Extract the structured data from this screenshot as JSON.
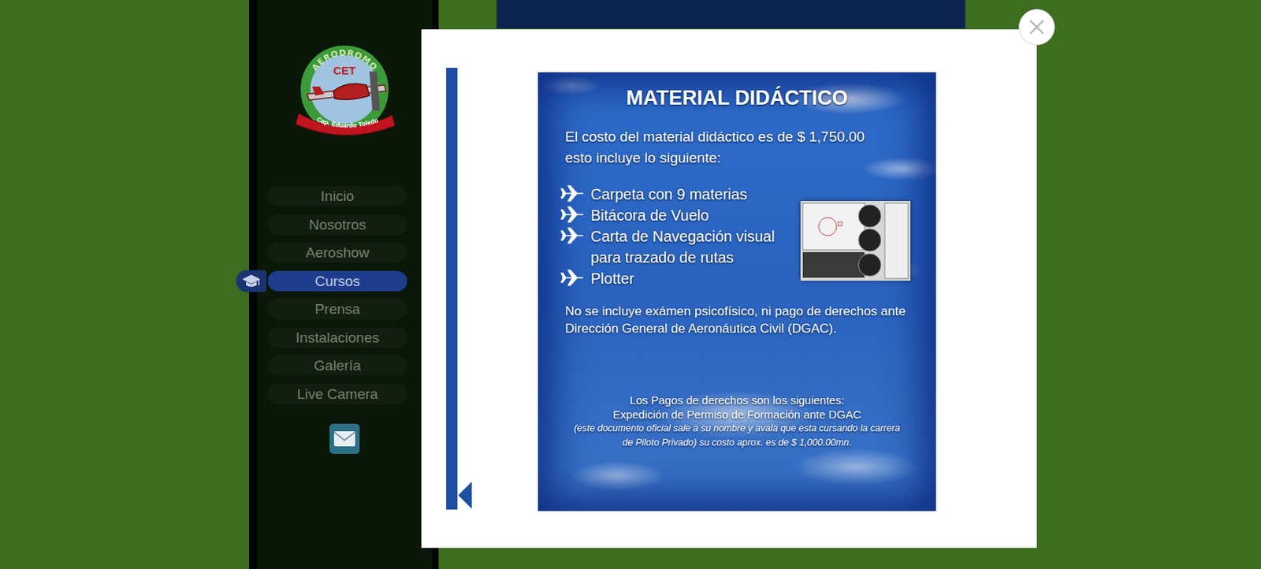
{
  "sidebar": {
    "logo": {
      "arc_text": "AERODROMO",
      "initials": "CET",
      "ribbon": "Cap. Eduardo Toledo"
    },
    "menu": [
      {
        "label": "Inicio",
        "selected": false
      },
      {
        "label": "Nosotros",
        "selected": false
      },
      {
        "label": "Aeroshow",
        "selected": false
      },
      {
        "label": "Cursos",
        "selected": true
      },
      {
        "label": "Prensa",
        "selected": false
      },
      {
        "label": "Instalaciones",
        "selected": false
      },
      {
        "label": "Galería",
        "selected": false
      },
      {
        "label": "Live Camera",
        "selected": false
      }
    ]
  },
  "slide": {
    "title": "MATERIAL DIDÁCTICO",
    "intro_lines": [
      "El costo del material didáctico es de $ 1,750.00",
      "esto incluye lo siguiente:"
    ],
    "items": [
      {
        "lines": [
          "Carpeta con 9 materias"
        ]
      },
      {
        "lines": [
          "Bitácora de Vuelo"
        ]
      },
      {
        "lines": [
          "Carta de Navegación visual",
          "para trazado de rutas"
        ]
      },
      {
        "lines": [
          "Plotter"
        ]
      }
    ],
    "note_lines": [
      "No se incluye exámen psicofísico, ni pago de derechos ante",
      "Dirección General de Aeronáutica Civil (DGAC)."
    ],
    "fees": {
      "heading": "Los Pagos de derechos son los siguientes:",
      "item": "Expedición de Permiso de Formación ante DGAC",
      "detail_lines": [
        "(este documento oficial sale a su nombre y avala que esta cursando la carrera",
        "de Piloto Privado) su costo aprox. es de $ 1,000.00mn."
      ]
    }
  }
}
